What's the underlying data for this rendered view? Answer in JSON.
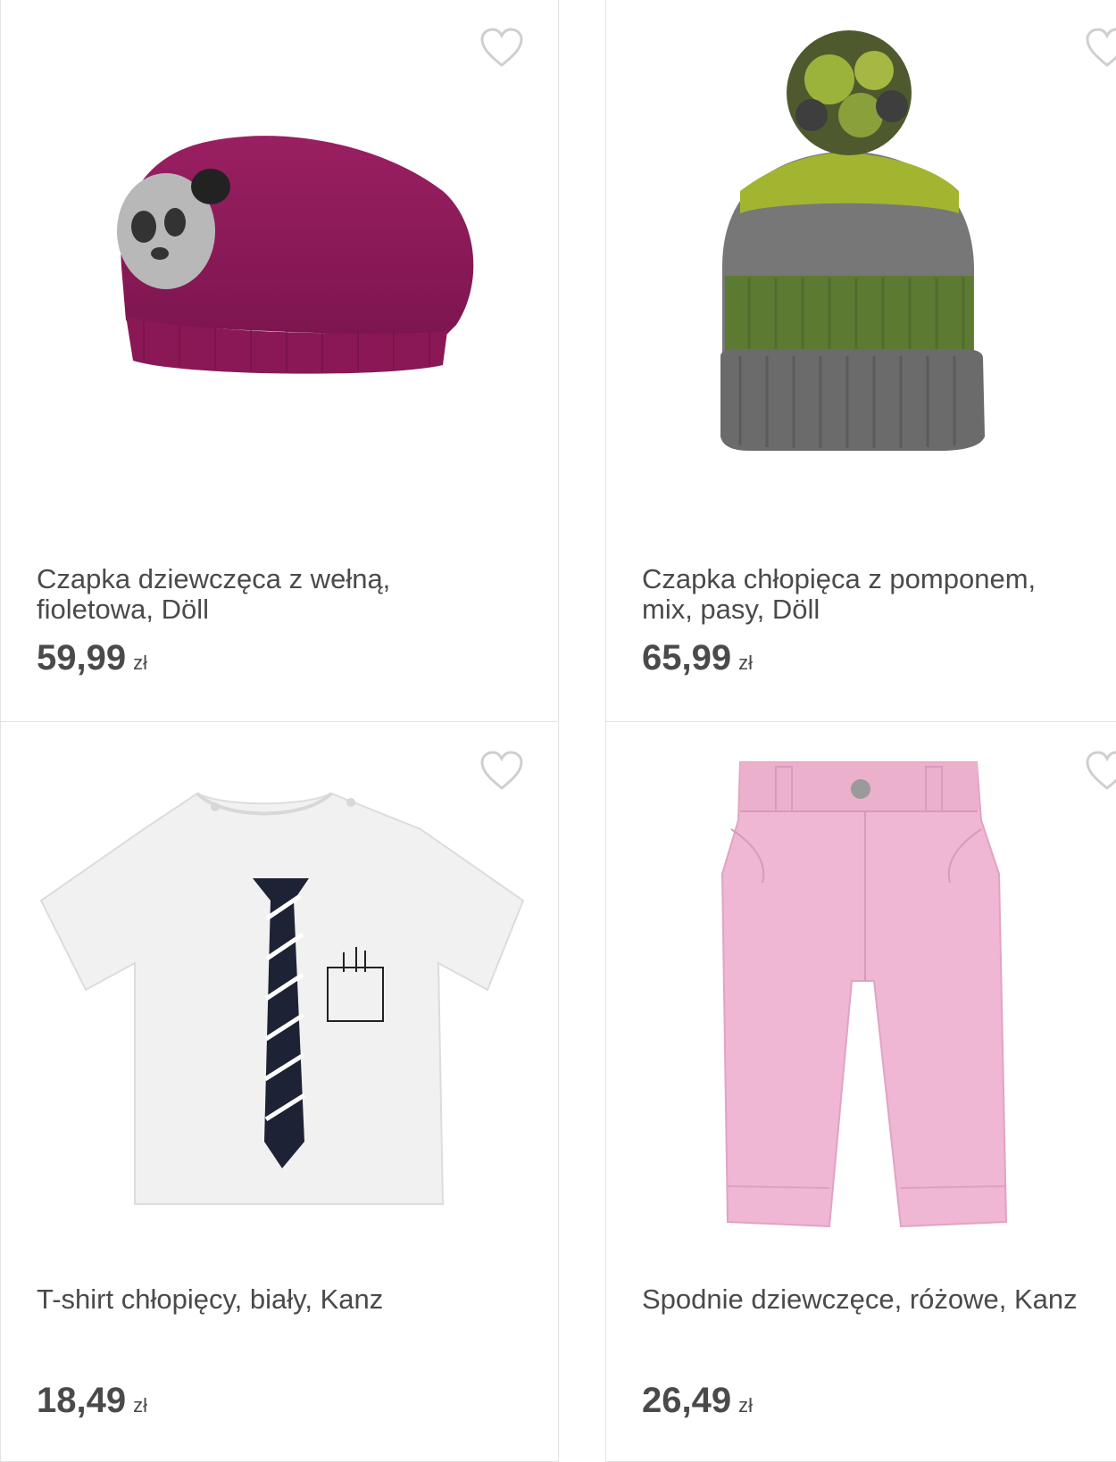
{
  "products": [
    {
      "title": "Czapka dziewczęca z wełną,\nfioletowa, Döll",
      "price": "59,99",
      "currency": "zł",
      "image_icon": "purple-beanie-image"
    },
    {
      "title": "Czapka chłopięca z pomponem,\nmix, pasy, Döll",
      "price": "65,99",
      "currency": "zł",
      "image_icon": "pompom-hat-image"
    },
    {
      "title": "T-shirt chłopięcy, biały, Kanz",
      "price": "18,49",
      "currency": "zł",
      "image_icon": "tshirt-tie-image"
    },
    {
      "title": "Spodnie dziewczęce, różowe, Kanz",
      "price": "26,49",
      "currency": "zł",
      "image_icon": "pink-trousers-image"
    }
  ],
  "colors": {
    "border": "#e2e2e2",
    "heart_outline": "#cfcfcf",
    "text": "#4a4a4a"
  }
}
